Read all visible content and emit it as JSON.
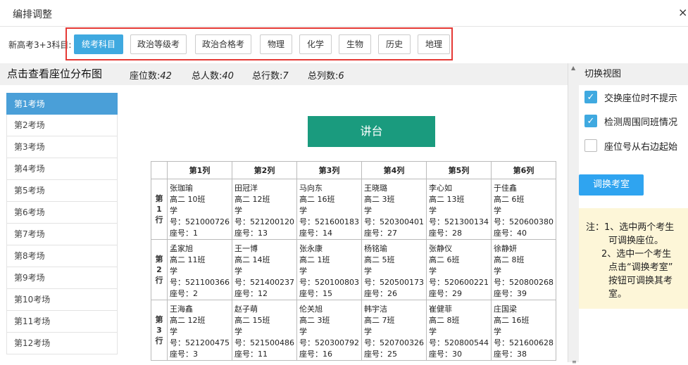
{
  "window": {
    "title": "编排调整",
    "close": "×"
  },
  "subjects": {
    "label": "新高考3+3科目:",
    "items": [
      {
        "label": "统考科目",
        "active": true
      },
      {
        "label": "政治等级考",
        "active": false
      },
      {
        "label": "政治合格考",
        "active": false
      },
      {
        "label": "物理",
        "active": false
      },
      {
        "label": "化学",
        "active": false
      },
      {
        "label": "生物",
        "active": false
      },
      {
        "label": "历史",
        "active": false
      },
      {
        "label": "地理",
        "active": false
      }
    ]
  },
  "seatmap": {
    "title": "点击查看座位分布图",
    "stats": [
      {
        "label": "座位数:",
        "value": "42"
      },
      {
        "label": "总人数:",
        "value": "40"
      },
      {
        "label": "总行数:",
        "value": "7"
      },
      {
        "label": "总列数:",
        "value": "6"
      }
    ],
    "podium": "讲台",
    "columns": [
      "第1列",
      "第2列",
      "第3列",
      "第4列",
      "第5列",
      "第6列"
    ],
    "rows": [
      {
        "label": [
          "第",
          "1",
          "行"
        ],
        "cells": [
          {
            "name": "张珈瑜",
            "cls": "高二 10班",
            "xue": "学",
            "num": "号：521000726",
            "seat": "座号：1"
          },
          {
            "name": "田冠洋",
            "cls": "高二 12班",
            "xue": "学",
            "num": "号：521200120",
            "seat": "座号：13"
          },
          {
            "name": "马向东",
            "cls": "高二 16班",
            "xue": "学",
            "num": "号：521600183",
            "seat": "座号：14"
          },
          {
            "name": "王晓璐",
            "cls": "高二 3班",
            "xue": "学",
            "num": "号：520300401",
            "seat": "座号：27"
          },
          {
            "name": "李心如",
            "cls": "高二 13班",
            "xue": "学",
            "num": "号：521300134",
            "seat": "座号：28"
          },
          {
            "name": "于佳鑫",
            "cls": "高二 6班",
            "xue": "学",
            "num": "号：520600380",
            "seat": "座号：40"
          }
        ]
      },
      {
        "label": [
          "第",
          "2",
          "行"
        ],
        "cells": [
          {
            "name": "孟家旭",
            "cls": "高二 11班",
            "xue": "学",
            "num": "号：521100366",
            "seat": "座号：2"
          },
          {
            "name": "王一博",
            "cls": "高二 14班",
            "xue": "学",
            "num": "号：521400237",
            "seat": "座号：12"
          },
          {
            "name": "张永康",
            "cls": "高二 1班",
            "xue": "学",
            "num": "号：520100803",
            "seat": "座号：15"
          },
          {
            "name": "杨铭瑜",
            "cls": "高二 5班",
            "xue": "学",
            "num": "号：520500173",
            "seat": "座号：26"
          },
          {
            "name": "张静仪",
            "cls": "高二 6班",
            "xue": "学",
            "num": "号：520600221",
            "seat": "座号：29"
          },
          {
            "name": "徐静妍",
            "cls": "高二 8班",
            "xue": "学",
            "num": "号：520800268",
            "seat": "座号：39"
          }
        ]
      },
      {
        "label": [
          "第",
          "3",
          "行"
        ],
        "cells": [
          {
            "name": "王海鑫",
            "cls": "高二 12班",
            "xue": "学",
            "num": "号：521200475",
            "seat": "座号：3"
          },
          {
            "name": "赵子萌",
            "cls": "高二 15班",
            "xue": "学",
            "num": "号：521500486",
            "seat": "座号：11"
          },
          {
            "name": "伦关旭",
            "cls": "高二 3班",
            "xue": "学",
            "num": "号：520300792",
            "seat": "座号：16"
          },
          {
            "name": "韩宇洁",
            "cls": "高二 7班",
            "xue": "学",
            "num": "号：520700326",
            "seat": "座号：25"
          },
          {
            "name": "崔健菲",
            "cls": "高二 8班",
            "xue": "学",
            "num": "号：520800544",
            "seat": "座号：30"
          },
          {
            "name": "庄国梁",
            "cls": "高二 16班",
            "xue": "学",
            "num": "号：521600628",
            "seat": "座号：38"
          }
        ]
      }
    ]
  },
  "sidebar": {
    "items": [
      "第1考场",
      "第2考场",
      "第3考场",
      "第4考场",
      "第5考场",
      "第6考场",
      "第7考场",
      "第8考场",
      "第9考场",
      "第10考场",
      "第11考场",
      "第12考场"
    ],
    "active_index": 0
  },
  "right_panel": {
    "title": "切换视图",
    "options": [
      {
        "label": "交换座位时不提示",
        "checked": true
      },
      {
        "label": "检测周围同班情况",
        "checked": true
      },
      {
        "label": "座位号从右边起始",
        "checked": false
      }
    ],
    "button": "调换考室",
    "note": {
      "line1": "注：1、选中两个考生",
      "line2": "可调换座位。",
      "line3": "2、选中一个考生",
      "line4": "点击“调换考室”",
      "line5": "按钮可调换其考",
      "line6": "室。"
    }
  },
  "scrollbar": {
    "up": "▲",
    "mid": "≡"
  },
  "colors": {
    "accent": "#3fa9e0",
    "podium": "#1a9b7e",
    "highlight": "#e53935",
    "note_bg": "#fdf6d8"
  }
}
